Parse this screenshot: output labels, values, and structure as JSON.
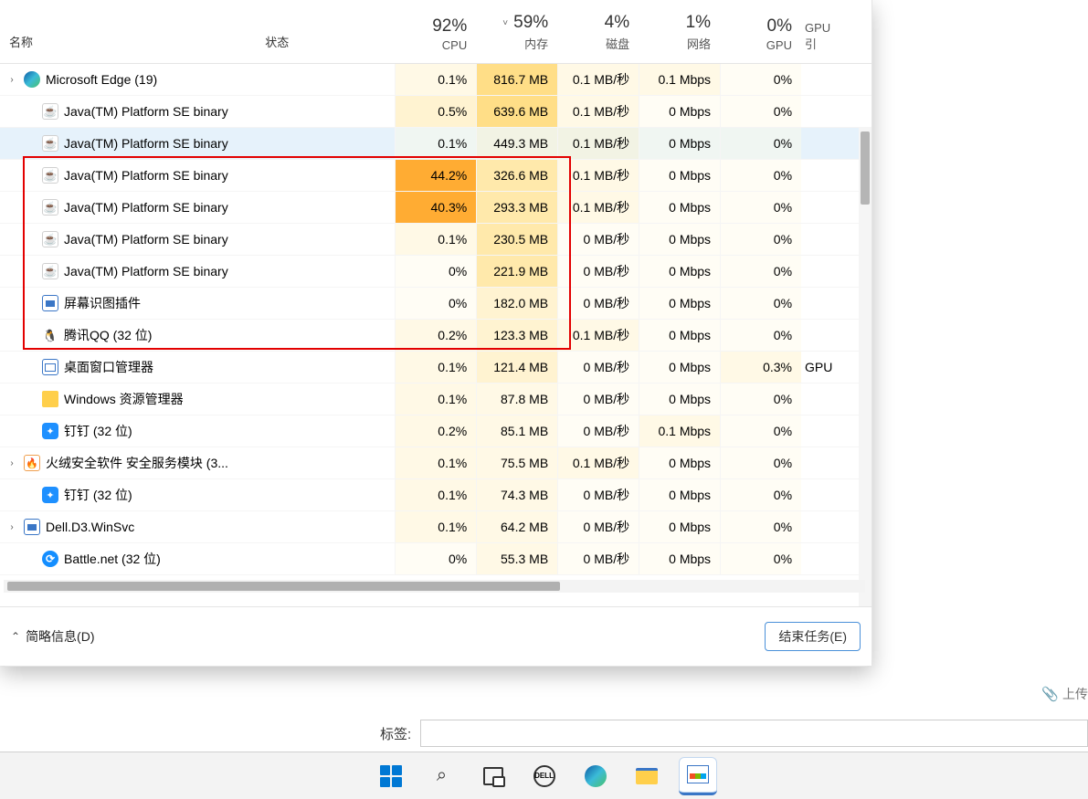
{
  "columns": {
    "name": "名称",
    "status": "状态",
    "cpu": {
      "value": "92%",
      "label": "CPU"
    },
    "mem": {
      "arrow": "˅",
      "value": "59%",
      "label": "内存"
    },
    "disk": {
      "value": "4%",
      "label": "磁盘"
    },
    "net": {
      "value": "1%",
      "label": "网络"
    },
    "gpu": {
      "value": "0%",
      "label": "GPU"
    },
    "gpu_engine": "GPU 引"
  },
  "processes": [
    {
      "exp": true,
      "iconClass": "edge",
      "name": "Microsoft Edge (19)",
      "cpu": "0.1%",
      "mem": "816.7 MB",
      "disk": "0.1 MB/秒",
      "net": "0.1 Mbps",
      "gpu": "0%",
      "gpu2": "",
      "selected": false
    },
    {
      "exp": false,
      "iconClass": "java",
      "name": "Java(TM) Platform SE binary",
      "cpu": "0.5%",
      "mem": "639.6 MB",
      "disk": "0.1 MB/秒",
      "net": "0 Mbps",
      "gpu": "0%",
      "gpu2": "",
      "selected": false
    },
    {
      "exp": false,
      "iconClass": "java",
      "name": "Java(TM) Platform SE binary",
      "cpu": "0.1%",
      "mem": "449.3 MB",
      "disk": "0.1 MB/秒",
      "net": "0 Mbps",
      "gpu": "0%",
      "gpu2": "",
      "selected": true
    },
    {
      "exp": false,
      "iconClass": "java",
      "name": "Java(TM) Platform SE binary",
      "cpu": "44.2%",
      "mem": "326.6 MB",
      "disk": "0.1 MB/秒",
      "net": "0 Mbps",
      "gpu": "0%",
      "gpu2": "",
      "selected": false
    },
    {
      "exp": false,
      "iconClass": "java",
      "name": "Java(TM) Platform SE binary",
      "cpu": "40.3%",
      "mem": "293.3 MB",
      "disk": "0.1 MB/秒",
      "net": "0 Mbps",
      "gpu": "0%",
      "gpu2": "",
      "selected": false
    },
    {
      "exp": false,
      "iconClass": "java",
      "name": "Java(TM) Platform SE binary",
      "cpu": "0.1%",
      "mem": "230.5 MB",
      "disk": "0 MB/秒",
      "net": "0 Mbps",
      "gpu": "0%",
      "gpu2": "",
      "selected": false
    },
    {
      "exp": false,
      "iconClass": "java",
      "name": "Java(TM) Platform SE binary",
      "cpu": "0%",
      "mem": "221.9 MB",
      "disk": "0 MB/秒",
      "net": "0 Mbps",
      "gpu": "0%",
      "gpu2": "",
      "selected": false
    },
    {
      "exp": false,
      "iconClass": "screen",
      "name": "屏幕识图插件",
      "cpu": "0%",
      "mem": "182.0 MB",
      "disk": "0 MB/秒",
      "net": "0 Mbps",
      "gpu": "0%",
      "gpu2": "",
      "selected": false
    },
    {
      "exp": false,
      "iconClass": "qq",
      "name": "腾讯QQ (32 位)",
      "cpu": "0.2%",
      "mem": "123.3 MB",
      "disk": "0.1 MB/秒",
      "net": "0 Mbps",
      "gpu": "0%",
      "gpu2": "",
      "selected": false
    },
    {
      "exp": false,
      "iconClass": "dwm",
      "name": "桌面窗口管理器",
      "cpu": "0.1%",
      "mem": "121.4 MB",
      "disk": "0 MB/秒",
      "net": "0 Mbps",
      "gpu": "0.3%",
      "gpu2": "GPU",
      "selected": false
    },
    {
      "exp": false,
      "iconClass": "folder",
      "name": "Windows 资源管理器",
      "cpu": "0.1%",
      "mem": "87.8 MB",
      "disk": "0 MB/秒",
      "net": "0 Mbps",
      "gpu": "0%",
      "gpu2": "",
      "selected": false
    },
    {
      "exp": false,
      "iconClass": "dingtalk",
      "name": "钉钉 (32 位)",
      "cpu": "0.2%",
      "mem": "85.1 MB",
      "disk": "0 MB/秒",
      "net": "0.1 Mbps",
      "gpu": "0%",
      "gpu2": "",
      "selected": false
    },
    {
      "exp": true,
      "iconClass": "huorong",
      "name": "火绒安全软件 安全服务模块 (3...",
      "cpu": "0.1%",
      "mem": "75.5 MB",
      "disk": "0.1 MB/秒",
      "net": "0 Mbps",
      "gpu": "0%",
      "gpu2": "",
      "selected": false
    },
    {
      "exp": false,
      "iconClass": "dingtalk",
      "name": "钉钉 (32 位)",
      "cpu": "0.1%",
      "mem": "74.3 MB",
      "disk": "0 MB/秒",
      "net": "0 Mbps",
      "gpu": "0%",
      "gpu2": "",
      "selected": false
    },
    {
      "exp": true,
      "iconClass": "dell",
      "name": "Dell.D3.WinSvc",
      "cpu": "0.1%",
      "mem": "64.2 MB",
      "disk": "0 MB/秒",
      "net": "0 Mbps",
      "gpu": "0%",
      "gpu2": "",
      "selected": false
    },
    {
      "exp": false,
      "iconClass": "bnet",
      "name": "Battle.net (32 位)",
      "cpu": "0%",
      "mem": "55.3 MB",
      "disk": "0 MB/秒",
      "net": "0 Mbps",
      "gpu": "0%",
      "gpu2": "",
      "selected": false
    }
  ],
  "footer": {
    "brief": "简略信息(D)",
    "end_task": "结束任务(E)"
  },
  "background": {
    "upload": "上传",
    "tags_label": "标签:"
  }
}
